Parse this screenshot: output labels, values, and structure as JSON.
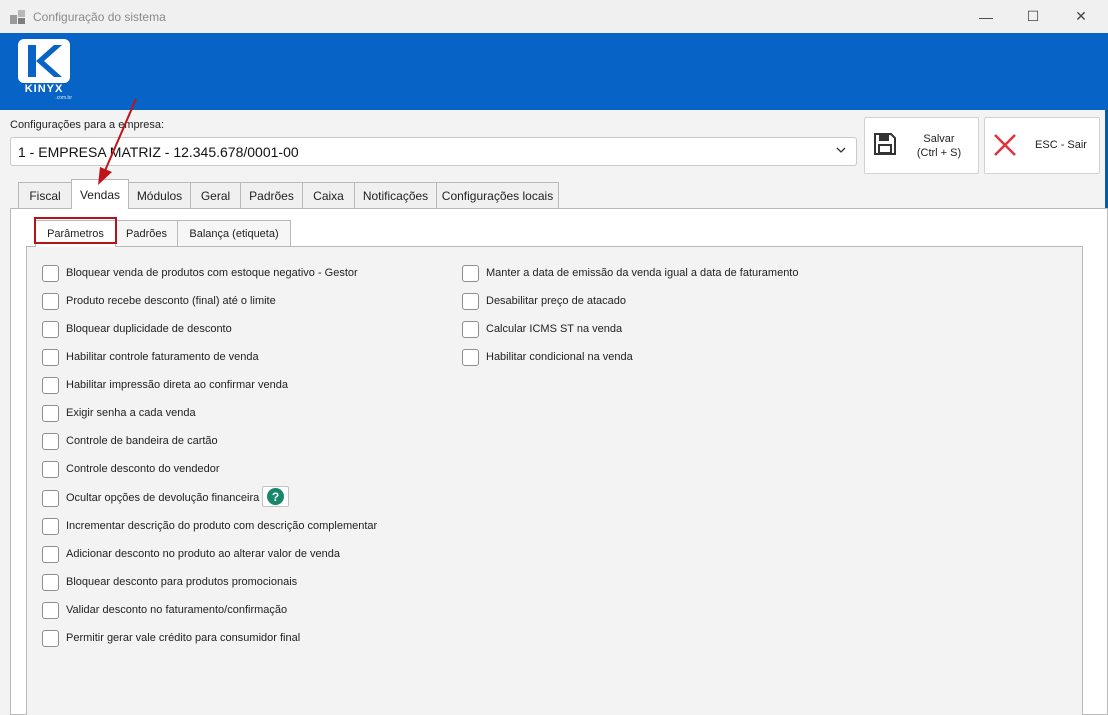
{
  "window": {
    "title": "Configuração do sistema",
    "minimize_glyph": "—",
    "maximize_glyph": "☐",
    "close_glyph": "✕"
  },
  "logo": {
    "text": "KINYX",
    "sub": ".com.br"
  },
  "company": {
    "label": "Configurações para a empresa:",
    "value": "1 - EMPRESA MATRIZ - 12.345.678/0001-00"
  },
  "actions": {
    "save_label": "Salvar\n(Ctrl + S)",
    "exit_label": "ESC - Sair"
  },
  "tabs": [
    {
      "label": "Fiscal"
    },
    {
      "label": "Vendas",
      "active": true
    },
    {
      "label": "Módulos"
    },
    {
      "label": "Geral"
    },
    {
      "label": "Padrões"
    },
    {
      "label": "Caixa"
    },
    {
      "label": "Notificações"
    },
    {
      "label": "Configurações locais"
    }
  ],
  "subtabs": [
    {
      "label": "Parâmetros",
      "active": true
    },
    {
      "label": "Padrões"
    },
    {
      "label": "Balança (etiqueta)"
    }
  ],
  "options_left": [
    {
      "label": "Bloquear venda de produtos com estoque negativo - Gestor",
      "checked": false
    },
    {
      "label": "Produto recebe desconto (final) até o limite",
      "checked": false
    },
    {
      "label": "Bloquear duplicidade de desconto",
      "checked": false
    },
    {
      "label": "Habilitar controle faturamento de venda",
      "checked": false
    },
    {
      "label": "Habilitar impressão direta ao confirmar venda",
      "checked": false
    },
    {
      "label": "Exigir senha a cada venda",
      "checked": false
    },
    {
      "label": "Controle de bandeira de cartão",
      "checked": false
    },
    {
      "label": "Controle desconto do vendedor",
      "checked": false
    },
    {
      "label": "Ocultar opções de devolução financeira",
      "checked": false
    },
    {
      "label": "Incrementar descrição do produto com descrição complementar",
      "checked": false
    },
    {
      "label": "Adicionar desconto no produto ao alterar valor de venda",
      "checked": false
    },
    {
      "label": "Bloquear desconto para produtos promocionais",
      "checked": false
    },
    {
      "label": "Validar desconto no faturamento/confirmação",
      "checked": false
    },
    {
      "label": "Permitir gerar vale crédito para consumidor final",
      "checked": false
    }
  ],
  "options_right": [
    {
      "label": "Manter a data de emissão da venda igual a data de faturamento",
      "checked": false
    },
    {
      "label": "Desabilitar preço de atacado",
      "checked": false
    },
    {
      "label": "Calcular ICMS ST na venda",
      "checked": false
    },
    {
      "label": "Habilitar condicional na venda",
      "checked": false
    }
  ],
  "help": {
    "glyph": "?"
  },
  "colors": {
    "banner": "#0764c6",
    "highlight": "#b3141b",
    "help": "#17866a"
  }
}
